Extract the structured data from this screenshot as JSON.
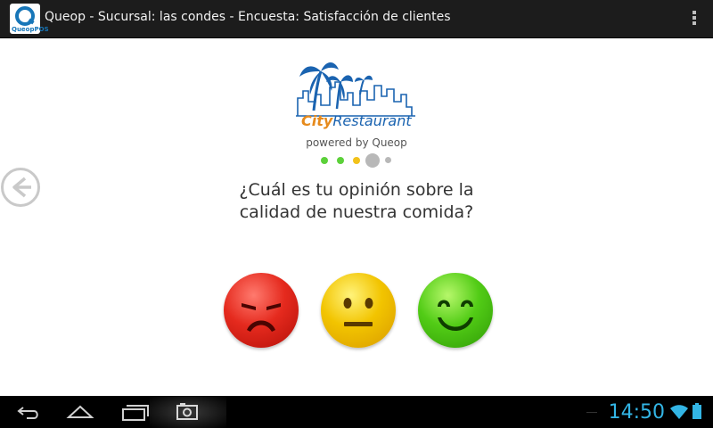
{
  "titlebar": {
    "title": "Queop - Sucursal: las condes - Encuesta: Satisfacción de clientes",
    "app_icon": "queop-pos-icon",
    "app_icon_caption": "QueopPOS",
    "menu_icon": "overflow-menu-icon"
  },
  "logo": {
    "city": "City",
    "restaurant": "Restaurant",
    "powered_by": "powered by Queop",
    "colors": {
      "city": "#e68a1c",
      "restaurant": "#1a63b0"
    }
  },
  "progress": {
    "steps": 5,
    "current_step": 4,
    "colors": [
      "#5cd13a",
      "#5cd13a",
      "#f2c21a",
      "#b8b8b8",
      "#b8b8b8"
    ]
  },
  "question": {
    "line1": "¿Cuál es tu opinión sobre la",
    "line2": "calidad de nuestra comida?"
  },
  "answers": [
    {
      "id": "bad",
      "icon": "sad-face-icon",
      "color": "#e52a1e"
    },
    {
      "id": "neutral",
      "icon": "neutral-face-icon",
      "color": "#f2c400"
    },
    {
      "id": "good",
      "icon": "happy-face-icon",
      "color": "#52cc16"
    }
  ],
  "navigation": {
    "back_icon": "back-arrow-icon"
  },
  "system_bar": {
    "time": "14:50",
    "icons": [
      "back-icon",
      "home-icon",
      "recent-apps-icon",
      "screenshot-icon",
      "wifi-icon",
      "battery-icon"
    ],
    "accent": "#33b5e5"
  }
}
